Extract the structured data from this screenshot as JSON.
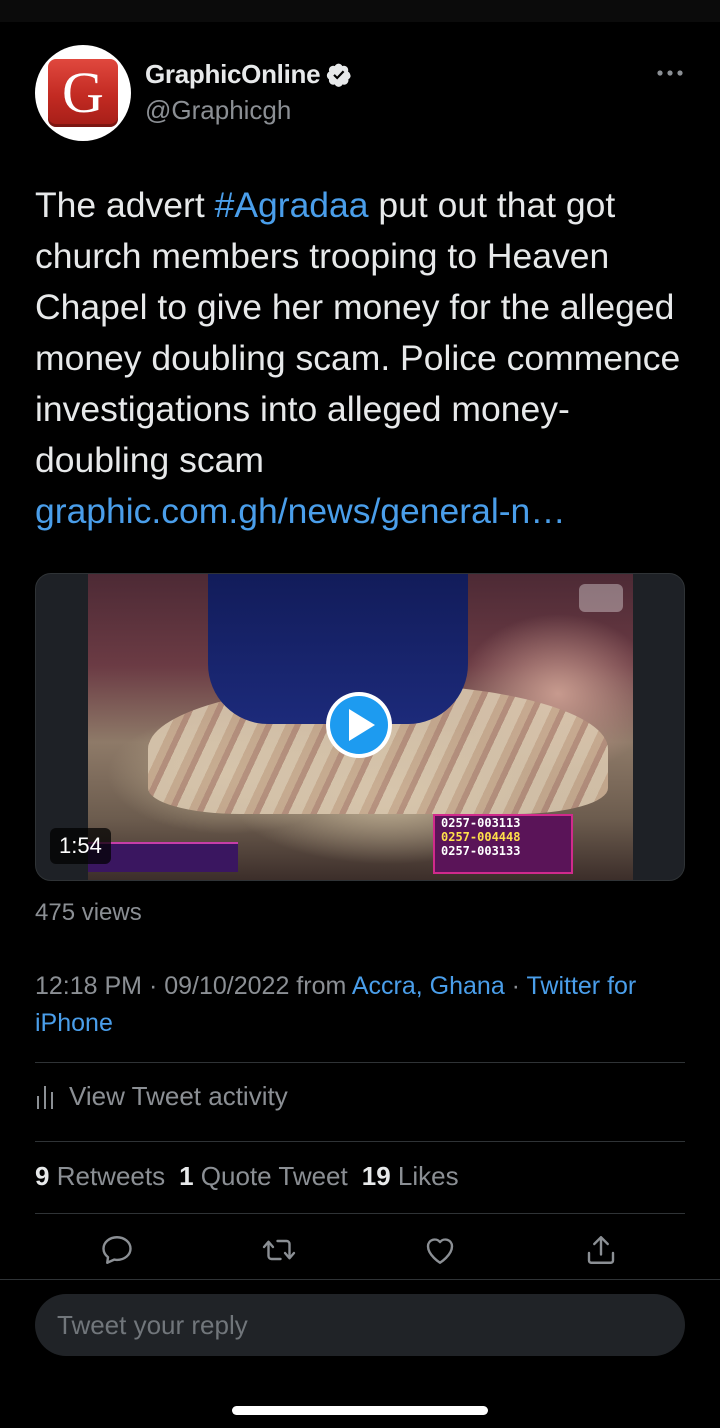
{
  "tweet": {
    "author": {
      "display_name": "GraphicOnline",
      "handle": "@Graphicgh",
      "avatar_letter": "G",
      "verified": true
    },
    "text_parts": {
      "before_hashtag": "The advert ",
      "hashtag": "#Agradaa",
      "after_hashtag": " put out that got church members trooping to Heaven Chapel to give her money for the alleged money doubling scam. Police commence investigations into alleged money-doubling scam ",
      "link": "graphic.com.gh/news/general-n…"
    },
    "media": {
      "duration": "1:54",
      "ticker_numbers": [
        "0257-003113",
        "0257-004448",
        "0257-003133"
      ]
    },
    "views": "475 views",
    "meta": {
      "time": "12:18 PM",
      "separator": " · ",
      "date": "09/10/2022",
      "from": " from ",
      "location": "Accra, Ghana",
      "separator2": " · ",
      "source": "Twitter for iPhone"
    },
    "activity_label": "View Tweet activity",
    "stats": {
      "retweets_count": "9",
      "retweets_label": "Retweets",
      "quotes_count": "1",
      "quotes_label": "Quote Tweet",
      "likes_count": "19",
      "likes_label": "Likes"
    }
  },
  "reply": {
    "placeholder": "Tweet your reply"
  },
  "colors": {
    "background": "#000000",
    "link_blue": "#4a9eea",
    "secondary_text": "#8b8f94",
    "play_button": "#1d9bf0"
  }
}
